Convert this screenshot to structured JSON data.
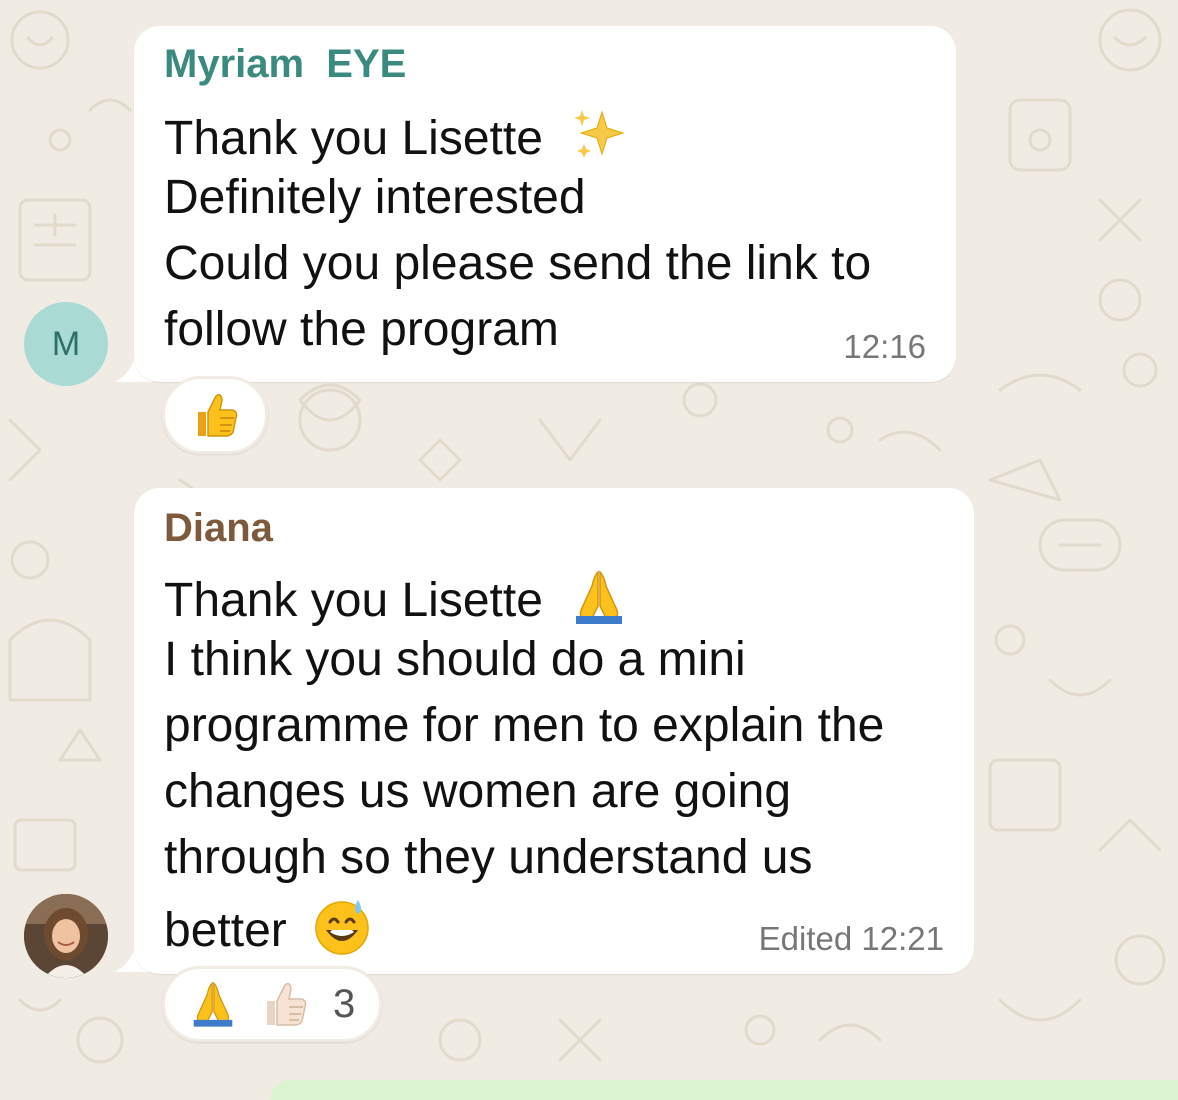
{
  "messages": [
    {
      "sender": "Myriam  EYE",
      "sender_color": "#3b8a80",
      "avatar": {
        "initial": "M",
        "color": "#a9dad3"
      },
      "lines": [
        "Thank you Lisette",
        "Definitely interested",
        "Could you please send the link to",
        "follow the program"
      ],
      "time": "12:16",
      "reactions": {
        "emojis": [
          "thumbs-up"
        ],
        "count": ""
      }
    },
    {
      "sender": "Diana",
      "sender_color": "#7d5a3b",
      "avatar": {
        "initial": "",
        "color": "#6b4f3a"
      },
      "lines": [
        "Thank you Lisette",
        "I think you should do a mini",
        "programme for men to explain the",
        "changes us women are going",
        "through so they understand us",
        "better"
      ],
      "time": "Edited 12:21",
      "reactions": {
        "emojis": [
          "folded-hands",
          "thumbs-up-light"
        ],
        "count": "3"
      }
    }
  ],
  "colors": {
    "background": "#f1ece3",
    "bubble": "#ffffff",
    "outgoing_bubble": "#dcf3d0"
  }
}
